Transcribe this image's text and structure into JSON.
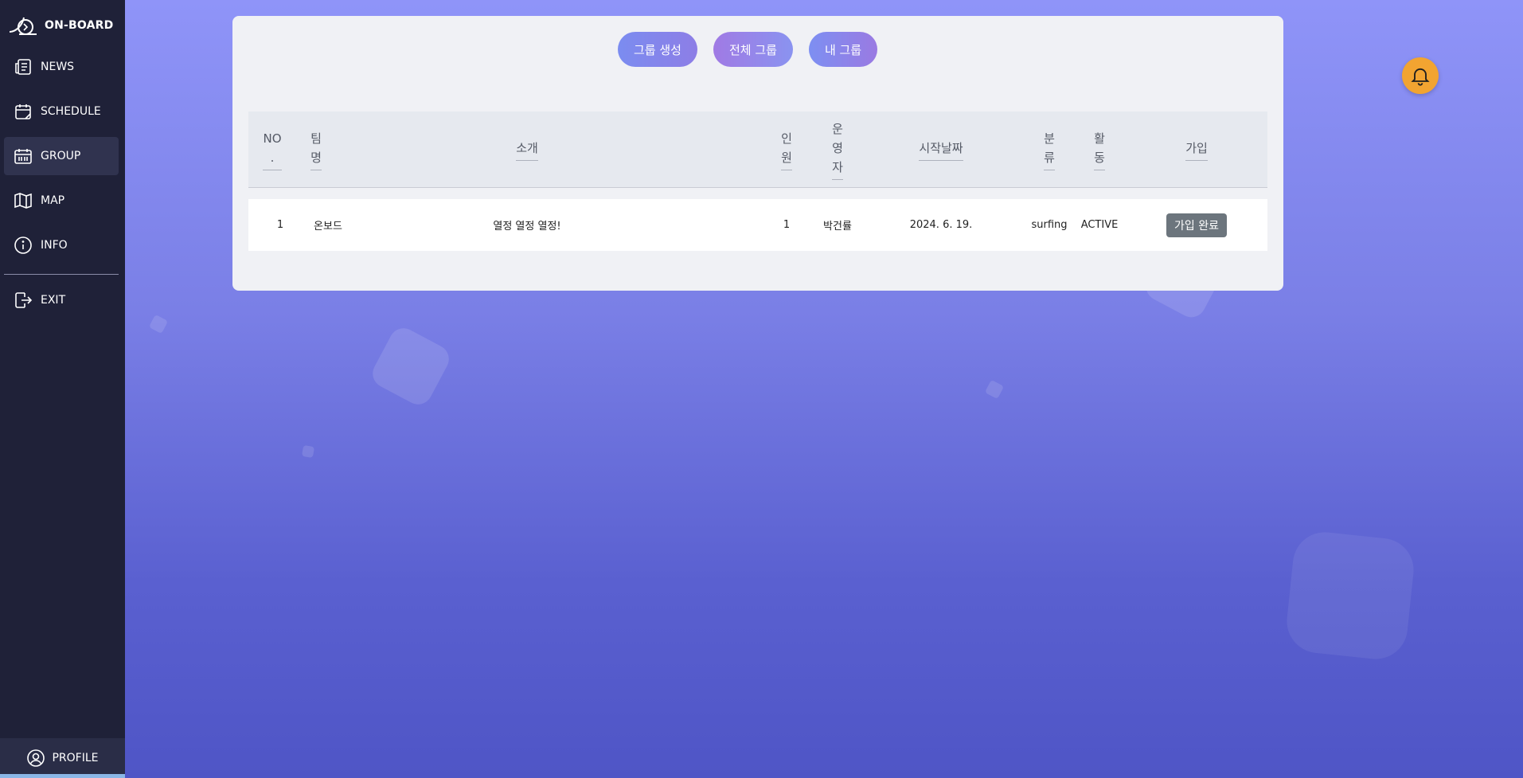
{
  "brand": {
    "name": "ON-BOARD"
  },
  "sidebar": {
    "items": [
      {
        "label": "NEWS",
        "icon": "news-icon"
      },
      {
        "label": "SCHEDULE",
        "icon": "calendar-icon"
      },
      {
        "label": "GROUP",
        "icon": "group-icon",
        "active": true
      },
      {
        "label": "MAP",
        "icon": "map-icon"
      },
      {
        "label": "INFO",
        "icon": "info-icon"
      },
      {
        "label": "EXIT",
        "icon": "exit-icon"
      }
    ],
    "profile": {
      "label": "PROFILE",
      "icon": "user-circle-icon"
    }
  },
  "tabs": {
    "create": "그룹 생성",
    "all": "전체 그룹",
    "mine": "내 그룹"
  },
  "table": {
    "headers": {
      "no": "NO\n.",
      "team": "팀\n명",
      "intro": "소개",
      "members": "인\n원",
      "owner": "운\n영\n자",
      "start": "시작날짜",
      "category": "분\n류",
      "activity": "활\n동",
      "join": "가입"
    },
    "rows": [
      {
        "no": "1",
        "team": "온보드",
        "intro": "열정 열정 열정!",
        "members": "1",
        "owner": "박건률",
        "start": "2024. 6. 19.",
        "category": "surfing",
        "activity": "ACTIVE",
        "join": "가입 완료"
      }
    ]
  },
  "colors": {
    "sidebar": "#1f2138",
    "accent": "#f2a431",
    "join_button": "#6c757d"
  },
  "notification": {
    "icon": "bell-icon"
  }
}
